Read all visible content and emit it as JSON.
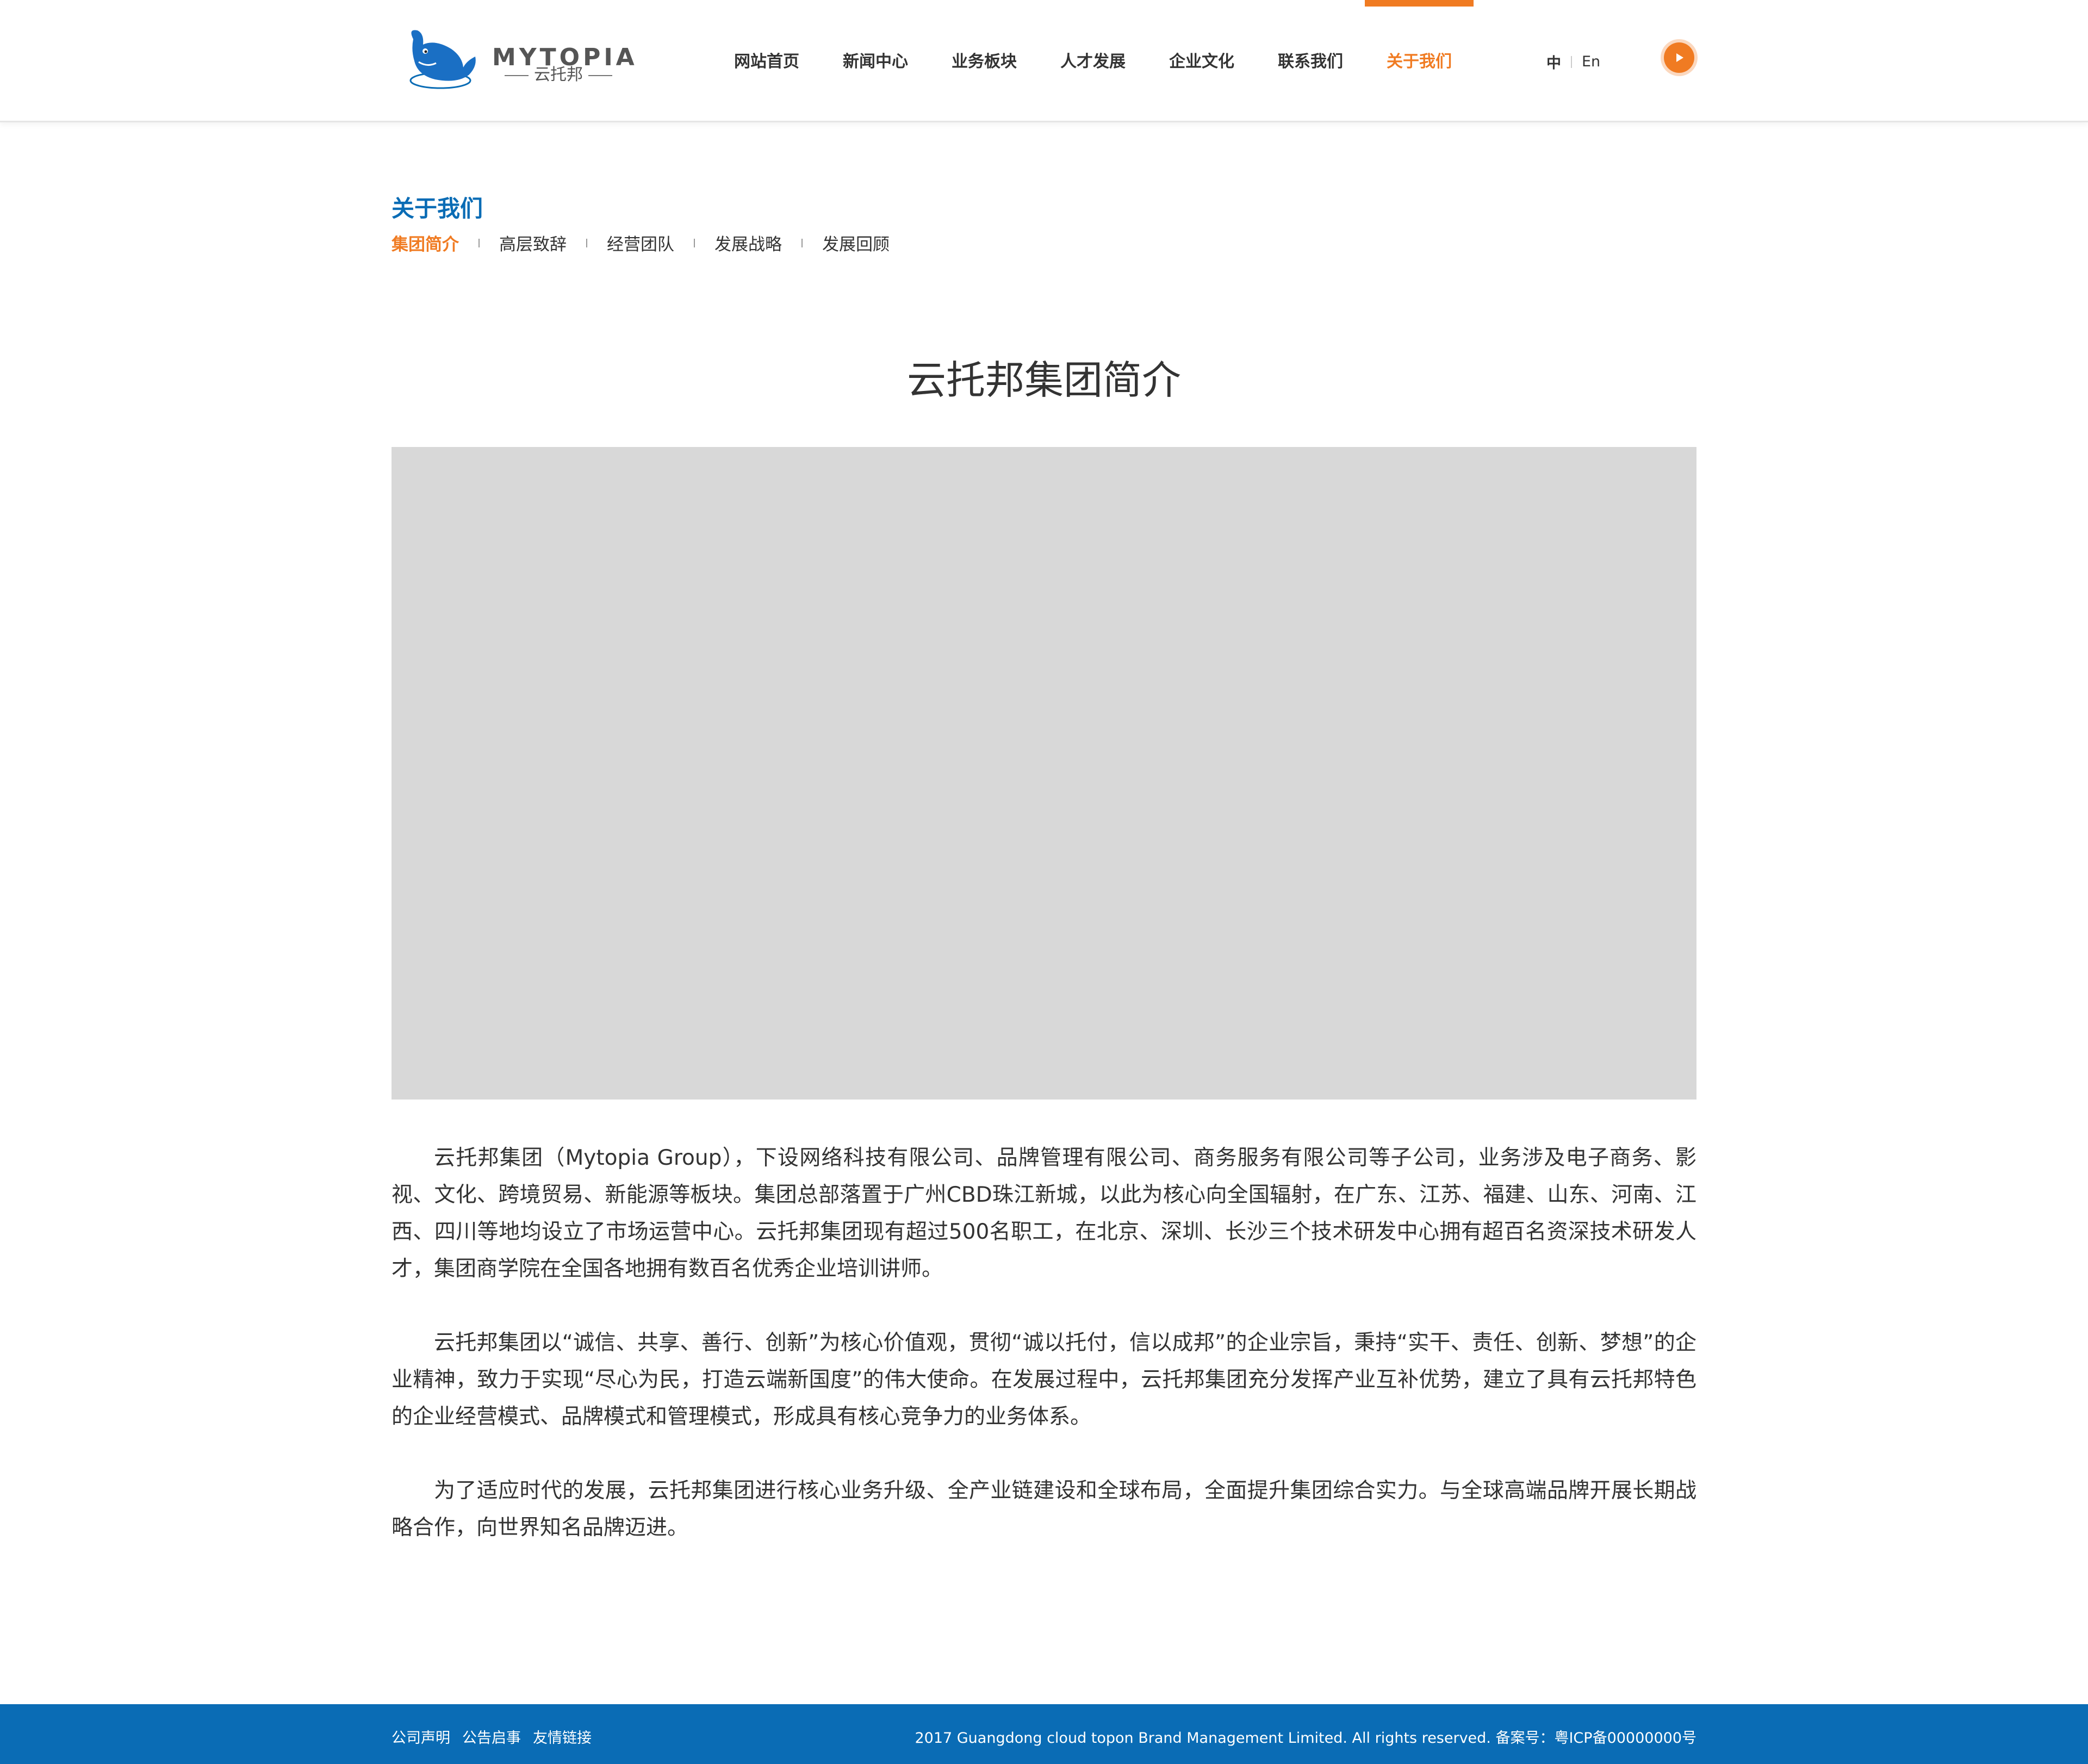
{
  "header": {
    "logo_text": "MYTOPIA",
    "logo_sub": "云托邦",
    "nav": [
      {
        "label": "网站首页"
      },
      {
        "label": "新闻中心"
      },
      {
        "label": "业务板块"
      },
      {
        "label": "人才发展"
      },
      {
        "label": "企业文化"
      },
      {
        "label": "联系我们"
      },
      {
        "label": "关于我们"
      }
    ],
    "active_nav": "关于我们",
    "lang_zh": "中",
    "lang_en": "En",
    "accent_color": "#f07b22"
  },
  "section": {
    "title": "关于我们",
    "title_color": "#0a6cb5",
    "subnav": [
      "集团简介",
      "高层致辞",
      "经营团队",
      "发展战略",
      "发展回顾"
    ],
    "active_subnav": "集团简介"
  },
  "main": {
    "title": "云托邦集团简介",
    "paragraphs": [
      "云托邦集团（Mytopia Group），下设网络科技有限公司、品牌管理有限公司、商务服务有限公司等子公司，业务涉及电子商务、影视、文化、跨境贸易、新能源等板块。集团总部落置于广州CBD珠江新城，以此为核心向全国辐射，在广东、江苏、福建、山东、河南、江西、四川等地均设立了市场运营中心。云托邦集团现有超过500名职工，在北京、深圳、长沙三个技术研发中心拥有超百名资深技术研发人才，集团商学院在全国各地拥有数百名优秀企业培训讲师。",
      "云托邦集团以“诚信、共享、善行、创新”为核心价值观，贯彻“诚以托付，信以成邦”的企业宗旨，秉持“实干、责任、创新、梦想”的企业精神，致力于实现“尽心为民，打造云端新国度”的伟大使命。在发展过程中，云托邦集团充分发挥产业互补优势，建立了具有云托邦特色的企业经营模式、品牌模式和管理模式，形成具有核心竞争力的业务体系。",
      "为了适应时代的发展，云托邦集团进行核心业务升级、全产业链建设和全球布局，全面提升集团综合实力。与全球高端品牌开展长期战略合作，向世界知名品牌迈进。"
    ]
  },
  "footer": {
    "links": [
      "公司声明",
      "公告启事",
      "友情链接"
    ],
    "copyright": "2017 Guangdong cloud topon Brand Management Limited. All rights reserved. 备案号：粤ICP备00000000号",
    "bg_color": "#0a6cb5"
  }
}
